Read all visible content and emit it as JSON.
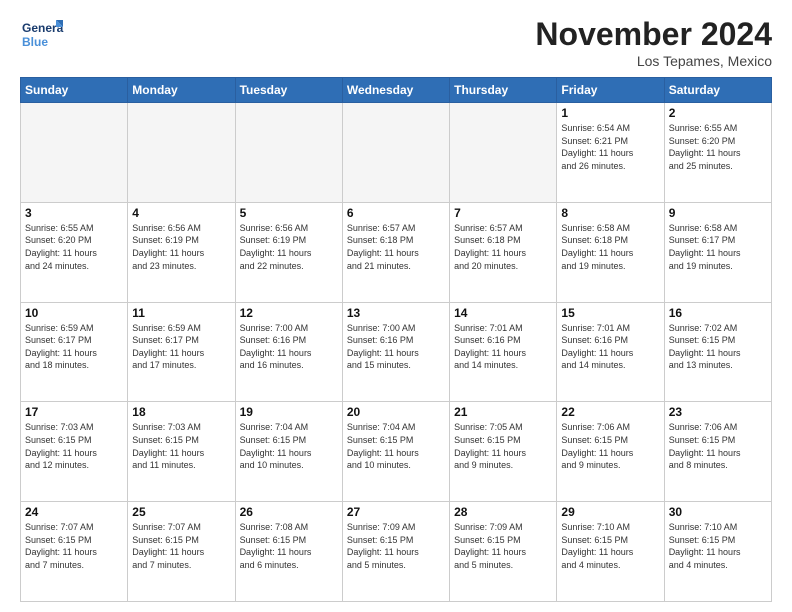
{
  "logo": {
    "line1": "General",
    "line2": "Blue"
  },
  "title": "November 2024",
  "location": "Los Tepames, Mexico",
  "headers": [
    "Sunday",
    "Monday",
    "Tuesday",
    "Wednesday",
    "Thursday",
    "Friday",
    "Saturday"
  ],
  "weeks": [
    [
      {
        "day": "",
        "info": ""
      },
      {
        "day": "",
        "info": ""
      },
      {
        "day": "",
        "info": ""
      },
      {
        "day": "",
        "info": ""
      },
      {
        "day": "",
        "info": ""
      },
      {
        "day": "1",
        "info": "Sunrise: 6:54 AM\nSunset: 6:21 PM\nDaylight: 11 hours\nand 26 minutes."
      },
      {
        "day": "2",
        "info": "Sunrise: 6:55 AM\nSunset: 6:20 PM\nDaylight: 11 hours\nand 25 minutes."
      }
    ],
    [
      {
        "day": "3",
        "info": "Sunrise: 6:55 AM\nSunset: 6:20 PM\nDaylight: 11 hours\nand 24 minutes."
      },
      {
        "day": "4",
        "info": "Sunrise: 6:56 AM\nSunset: 6:19 PM\nDaylight: 11 hours\nand 23 minutes."
      },
      {
        "day": "5",
        "info": "Sunrise: 6:56 AM\nSunset: 6:19 PM\nDaylight: 11 hours\nand 22 minutes."
      },
      {
        "day": "6",
        "info": "Sunrise: 6:57 AM\nSunset: 6:18 PM\nDaylight: 11 hours\nand 21 minutes."
      },
      {
        "day": "7",
        "info": "Sunrise: 6:57 AM\nSunset: 6:18 PM\nDaylight: 11 hours\nand 20 minutes."
      },
      {
        "day": "8",
        "info": "Sunrise: 6:58 AM\nSunset: 6:18 PM\nDaylight: 11 hours\nand 19 minutes."
      },
      {
        "day": "9",
        "info": "Sunrise: 6:58 AM\nSunset: 6:17 PM\nDaylight: 11 hours\nand 19 minutes."
      }
    ],
    [
      {
        "day": "10",
        "info": "Sunrise: 6:59 AM\nSunset: 6:17 PM\nDaylight: 11 hours\nand 18 minutes."
      },
      {
        "day": "11",
        "info": "Sunrise: 6:59 AM\nSunset: 6:17 PM\nDaylight: 11 hours\nand 17 minutes."
      },
      {
        "day": "12",
        "info": "Sunrise: 7:00 AM\nSunset: 6:16 PM\nDaylight: 11 hours\nand 16 minutes."
      },
      {
        "day": "13",
        "info": "Sunrise: 7:00 AM\nSunset: 6:16 PM\nDaylight: 11 hours\nand 15 minutes."
      },
      {
        "day": "14",
        "info": "Sunrise: 7:01 AM\nSunset: 6:16 PM\nDaylight: 11 hours\nand 14 minutes."
      },
      {
        "day": "15",
        "info": "Sunrise: 7:01 AM\nSunset: 6:16 PM\nDaylight: 11 hours\nand 14 minutes."
      },
      {
        "day": "16",
        "info": "Sunrise: 7:02 AM\nSunset: 6:15 PM\nDaylight: 11 hours\nand 13 minutes."
      }
    ],
    [
      {
        "day": "17",
        "info": "Sunrise: 7:03 AM\nSunset: 6:15 PM\nDaylight: 11 hours\nand 12 minutes."
      },
      {
        "day": "18",
        "info": "Sunrise: 7:03 AM\nSunset: 6:15 PM\nDaylight: 11 hours\nand 11 minutes."
      },
      {
        "day": "19",
        "info": "Sunrise: 7:04 AM\nSunset: 6:15 PM\nDaylight: 11 hours\nand 10 minutes."
      },
      {
        "day": "20",
        "info": "Sunrise: 7:04 AM\nSunset: 6:15 PM\nDaylight: 11 hours\nand 10 minutes."
      },
      {
        "day": "21",
        "info": "Sunrise: 7:05 AM\nSunset: 6:15 PM\nDaylight: 11 hours\nand 9 minutes."
      },
      {
        "day": "22",
        "info": "Sunrise: 7:06 AM\nSunset: 6:15 PM\nDaylight: 11 hours\nand 9 minutes."
      },
      {
        "day": "23",
        "info": "Sunrise: 7:06 AM\nSunset: 6:15 PM\nDaylight: 11 hours\nand 8 minutes."
      }
    ],
    [
      {
        "day": "24",
        "info": "Sunrise: 7:07 AM\nSunset: 6:15 PM\nDaylight: 11 hours\nand 7 minutes."
      },
      {
        "day": "25",
        "info": "Sunrise: 7:07 AM\nSunset: 6:15 PM\nDaylight: 11 hours\nand 7 minutes."
      },
      {
        "day": "26",
        "info": "Sunrise: 7:08 AM\nSunset: 6:15 PM\nDaylight: 11 hours\nand 6 minutes."
      },
      {
        "day": "27",
        "info": "Sunrise: 7:09 AM\nSunset: 6:15 PM\nDaylight: 11 hours\nand 5 minutes."
      },
      {
        "day": "28",
        "info": "Sunrise: 7:09 AM\nSunset: 6:15 PM\nDaylight: 11 hours\nand 5 minutes."
      },
      {
        "day": "29",
        "info": "Sunrise: 7:10 AM\nSunset: 6:15 PM\nDaylight: 11 hours\nand 4 minutes."
      },
      {
        "day": "30",
        "info": "Sunrise: 7:10 AM\nSunset: 6:15 PM\nDaylight: 11 hours\nand 4 minutes."
      }
    ]
  ]
}
